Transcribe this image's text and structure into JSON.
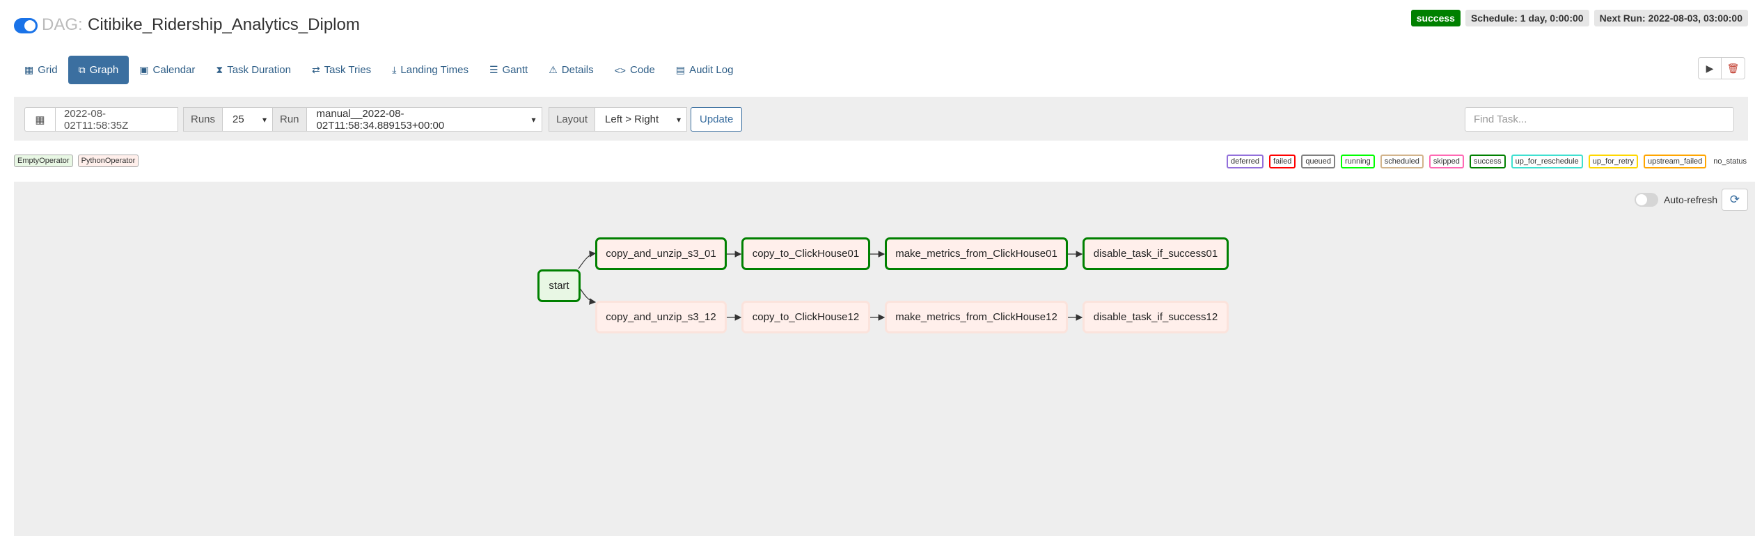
{
  "header": {
    "prefix": "DAG:",
    "title": "Citibike_Ridership_Analytics_Diplom",
    "badges": [
      "success",
      "Schedule: 1 day, 0:00:00",
      "Next Run: 2022-08-03, 03:00:00"
    ]
  },
  "nav": {
    "tabs": [
      {
        "label": "Grid",
        "icon": "grid-icon"
      },
      {
        "label": "Graph",
        "icon": "graph-icon"
      },
      {
        "label": "Calendar",
        "icon": "calendar-icon"
      },
      {
        "label": "Task Duration",
        "icon": "hourglass-icon"
      },
      {
        "label": "Task Tries",
        "icon": "repeat-icon"
      },
      {
        "label": "Landing Times",
        "icon": "landing-icon"
      },
      {
        "label": "Gantt",
        "icon": "gantt-icon"
      },
      {
        "label": "Details",
        "icon": "warning-icon"
      },
      {
        "label": "Code",
        "icon": "code-icon"
      },
      {
        "label": "Audit Log",
        "icon": "audit-icon"
      }
    ],
    "active": "Graph"
  },
  "filters": {
    "base_date": "2022-08-02T11:58:35Z",
    "runs_label": "Runs",
    "runs_value": "25",
    "run_label": "Run",
    "run_value": "manual__2022-08-02T11:58:34.889153+00:00",
    "layout_label": "Layout",
    "layout_value": "Left > Right",
    "update_label": "Update",
    "find_placeholder": "Find Task..."
  },
  "operators": [
    "EmptyOperator",
    "PythonOperator"
  ],
  "states": [
    {
      "label": "deferred",
      "color": "#9370db"
    },
    {
      "label": "failed",
      "color": "#ff0000"
    },
    {
      "label": "queued",
      "color": "#808080"
    },
    {
      "label": "running",
      "color": "#00ff00"
    },
    {
      "label": "scheduled",
      "color": "#d2b48c"
    },
    {
      "label": "skipped",
      "color": "#ff69b4"
    },
    {
      "label": "success",
      "color": "#008000"
    },
    {
      "label": "up_for_reschedule",
      "color": "#40e0d0"
    },
    {
      "label": "up_for_retry",
      "color": "#ffd700"
    },
    {
      "label": "upstream_failed",
      "color": "#ffa500"
    },
    {
      "label": "no_status",
      "color": "none"
    }
  ],
  "graph": {
    "auto_refresh_label": "Auto-refresh",
    "start": "start",
    "row1": [
      "copy_and_unzip_s3_01",
      "copy_to_ClickHouse01",
      "make_metrics_from_ClickHouse01",
      "disable_task_if_success01"
    ],
    "row2": [
      "copy_and_unzip_s3_12",
      "copy_to_ClickHouse12",
      "make_metrics_from_ClickHouse12",
      "disable_task_if_success12"
    ]
  }
}
